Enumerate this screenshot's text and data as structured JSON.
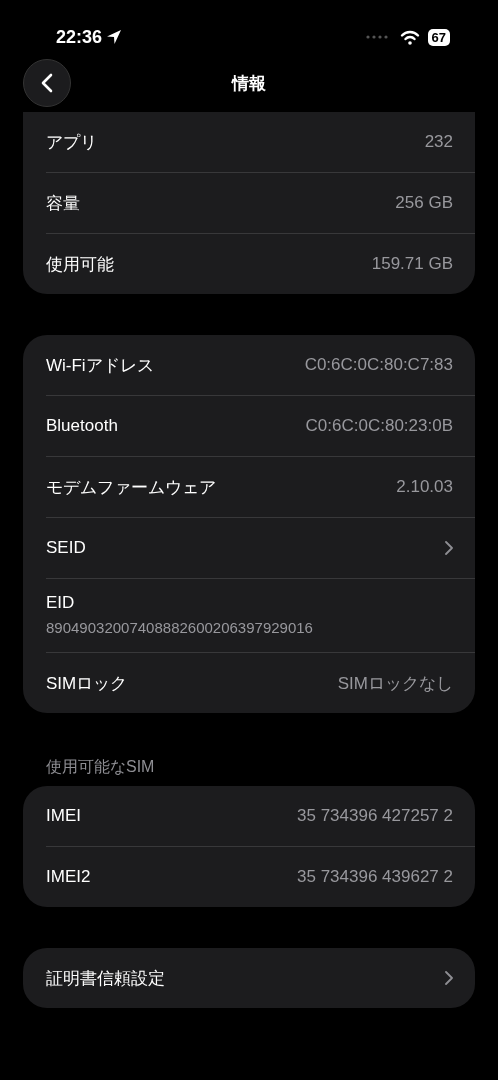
{
  "status_bar": {
    "time": "22:36",
    "battery": "67"
  },
  "nav": {
    "title": "情報"
  },
  "groups": [
    {
      "rows": [
        {
          "kind": "value",
          "label": "アプリ",
          "value": "232"
        },
        {
          "kind": "value",
          "label": "容量",
          "value": "256 GB"
        },
        {
          "kind": "value",
          "label": "使用可能",
          "value": "159.71 GB"
        }
      ]
    },
    {
      "rows": [
        {
          "kind": "value",
          "label": "Wi-Fiアドレス",
          "value": "C0:6C:0C:80:C7:83"
        },
        {
          "kind": "value",
          "label": "Bluetooth",
          "value": "C0:6C:0C:80:23:0B"
        },
        {
          "kind": "value",
          "label": "モデムファームウェア",
          "value": "2.10.03"
        },
        {
          "kind": "link",
          "label": "SEID"
        },
        {
          "kind": "subtitle",
          "label": "EID",
          "value": "89049032007408882600206397929016"
        },
        {
          "kind": "value",
          "label": "SIMロック",
          "value": "SIMロックなし"
        }
      ]
    },
    {
      "header": "使用可能なSIM",
      "rows": [
        {
          "kind": "value",
          "label": "IMEI",
          "value": "35 734396 427257 2"
        },
        {
          "kind": "value",
          "label": "IMEI2",
          "value": "35 734396 439627 2"
        }
      ]
    },
    {
      "rows": [
        {
          "kind": "link",
          "label": "証明書信頼設定"
        }
      ]
    }
  ]
}
